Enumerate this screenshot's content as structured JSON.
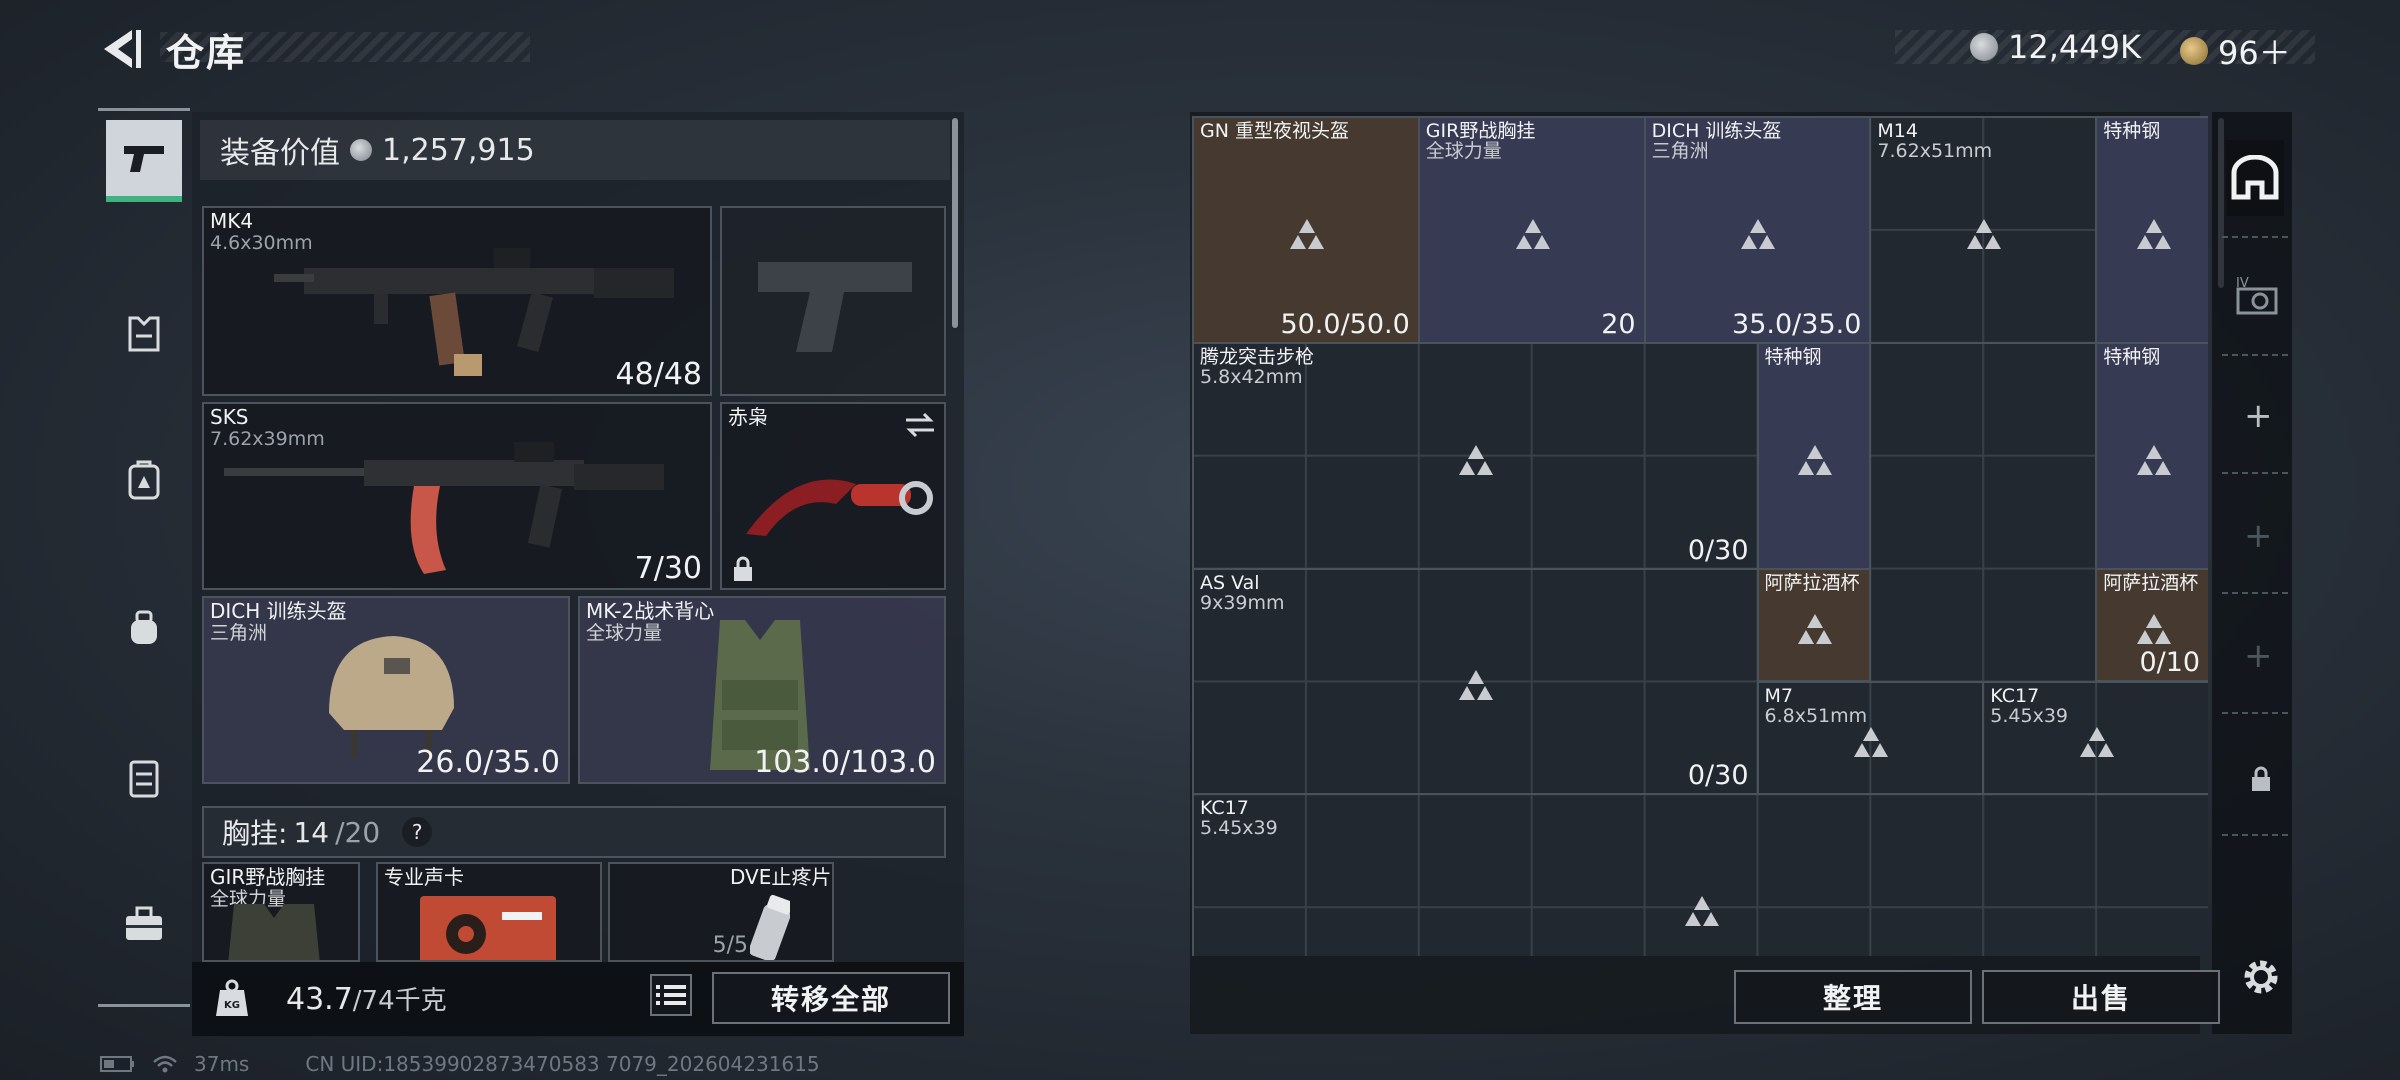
{
  "header": {
    "title": "仓库",
    "currency_a": "12,449K",
    "currency_b": "96＋"
  },
  "left_tabs": [
    "gun-icon",
    "armor-icon",
    "backpack-icon",
    "bag-icon",
    "chest-rig-icon",
    "toolbox-icon"
  ],
  "equipment": {
    "value_label": "装备价值",
    "value": "1,257,915",
    "primary": {
      "name": "MK4",
      "caliber": "4.6x30mm",
      "ammo": "48/48"
    },
    "secondary": {
      "name": "SKS",
      "caliber": "7.62x39mm",
      "ammo": "7/30"
    },
    "melee": {
      "name": "赤枭"
    },
    "helmet": {
      "name": "DICH 训练头盔",
      "brand": "三角洲",
      "durability": "26.0/35.0"
    },
    "vest": {
      "name": "MK-2战术背心",
      "brand": "全球力量",
      "durability": "103.0/103.0"
    },
    "chest": {
      "label": "胸挂:",
      "used": "14",
      "total": "/20",
      "help": "?"
    },
    "chest_items": [
      {
        "name": "GIR野战胸挂",
        "brand": "全球力量"
      },
      {
        "name": "专业声卡"
      },
      {
        "name": "DVE止疼片",
        "count": "5/5"
      }
    ]
  },
  "footer": {
    "weight": "43.7",
    "weight_max": "/74千克",
    "transfer_all": "转移全部",
    "sort": "整理",
    "sell": "出售"
  },
  "storage": [
    {
      "name": "GN 重型夜视头盔",
      "count": "50.0/50.0",
      "color": "#463a30"
    },
    {
      "name": "GIR野战胸挂",
      "sub": "全球力量",
      "count": "20",
      "color": "#363a52"
    },
    {
      "name": "DICH 训练头盔",
      "sub": "三角洲",
      "count": "35.0/35.0",
      "color": "#363a52"
    },
    {
      "name": "M14",
      "sub": "7.62x51mm"
    },
    {
      "name": "特种钢",
      "color": "#363a52"
    },
    {
      "name": "腾龙突击步枪",
      "sub": "5.8x42mm",
      "count": "0/30"
    },
    {
      "name": "特种钢",
      "color": "#363a52"
    },
    {
      "name": "特种钢",
      "color": "#363a52"
    },
    {
      "name": "AS Val",
      "sub": "9x39mm",
      "count": "0/30"
    },
    {
      "name": "阿萨拉酒杯",
      "color": "#463a30"
    },
    {
      "name": "阿萨拉酒杯",
      "color": "#463a30",
      "count": "0/10"
    },
    {
      "name": "M7",
      "sub": "6.8x51mm"
    },
    {
      "name": "KC17",
      "sub": "5.45x39"
    },
    {
      "name": "KC17",
      "sub": "5.45x39"
    }
  ],
  "status": {
    "ping": "37ms",
    "uid": "CN UID:18539902873470583 7079_202604231615"
  }
}
